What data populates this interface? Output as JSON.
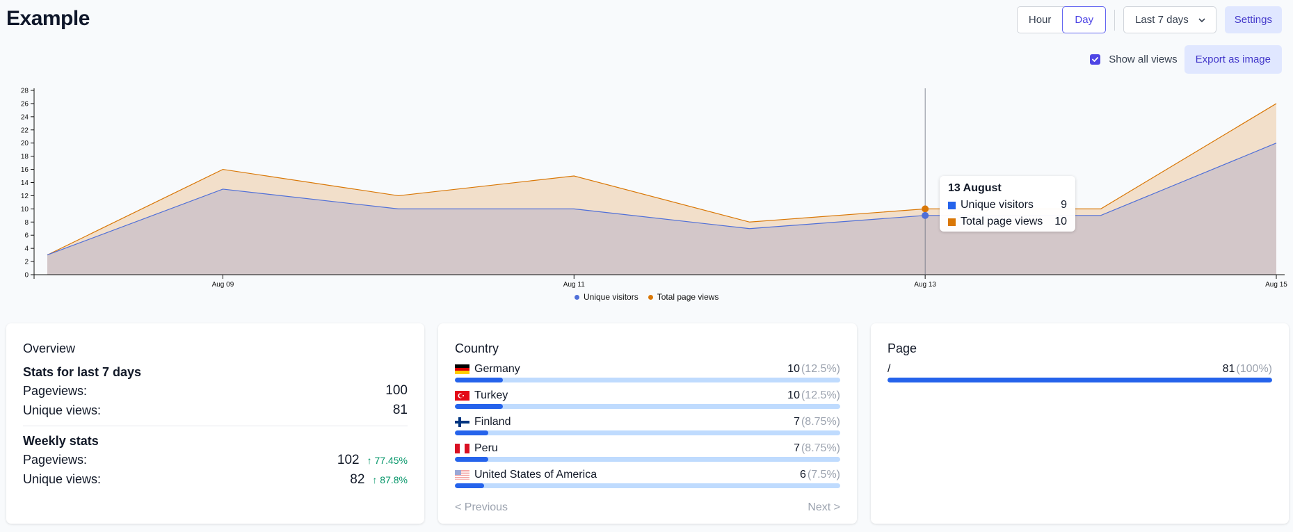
{
  "header": {
    "title": "Example",
    "toggle_hour": "Hour",
    "toggle_day": "Day",
    "range_select": "Last 7 days",
    "settings_label": "Settings"
  },
  "controls": {
    "show_all_views_label": "Show all views",
    "show_all_views_checked": true,
    "export_label": "Export as image"
  },
  "chart_data": {
    "type": "area",
    "x": [
      "Aug 08",
      "Aug 09",
      "Aug 10",
      "Aug 11",
      "Aug 12",
      "Aug 13",
      "Aug 14",
      "Aug 15"
    ],
    "x_tick_labels": [
      "Aug 09",
      "Aug 11",
      "Aug 13",
      "Aug 15"
    ],
    "y_ticks": [
      0,
      2,
      4,
      6,
      8,
      10,
      12,
      14,
      16,
      18,
      20,
      22,
      24,
      26,
      28
    ],
    "ylim": [
      0,
      28
    ],
    "series": [
      {
        "name": "Unique visitors",
        "values": [
          3,
          13,
          10,
          10,
          7,
          9,
          9,
          20
        ],
        "color": "#4f6fd8"
      },
      {
        "name": "Total page views",
        "values": [
          3,
          16,
          12,
          15,
          8,
          10,
          10,
          26
        ],
        "color": "#d97706"
      }
    ],
    "legend_position": "bottom-center",
    "hover_index": 5,
    "tooltip": {
      "title": "13 August",
      "rows": [
        {
          "label": "Unique visitors",
          "value": "9",
          "color": "#2563eb"
        },
        {
          "label": "Total page views",
          "value": "10",
          "color": "#d97706"
        }
      ]
    }
  },
  "overview": {
    "title": "Overview",
    "stats_heading": "Stats for last 7 days",
    "pageviews_label": "Pageviews:",
    "pageviews_value": "100",
    "unique_label": "Unique views:",
    "unique_value": "81",
    "weekly_heading": "Weekly stats",
    "weekly_pageviews_label": "Pageviews:",
    "weekly_pageviews_value": "102",
    "weekly_pageviews_delta": "77.45%",
    "weekly_unique_label": "Unique views:",
    "weekly_unique_value": "82",
    "weekly_unique_delta": "87.8%"
  },
  "country": {
    "title": "Country",
    "items": [
      {
        "name": "Germany",
        "count": "10",
        "pct": "(12.5%)",
        "fraction": 0.125,
        "flag": "de"
      },
      {
        "name": "Turkey",
        "count": "10",
        "pct": "(12.5%)",
        "fraction": 0.125,
        "flag": "tr"
      },
      {
        "name": "Finland",
        "count": "7",
        "pct": "(8.75%)",
        "fraction": 0.0875,
        "flag": "fi"
      },
      {
        "name": "Peru",
        "count": "7",
        "pct": "(8.75%)",
        "fraction": 0.0875,
        "flag": "pe"
      },
      {
        "name": "United States of America",
        "count": "6",
        "pct": "(7.5%)",
        "fraction": 0.075,
        "flag": "us"
      }
    ],
    "prev_label": "< Previous",
    "next_label": "Next >"
  },
  "page": {
    "title": "Page",
    "items": [
      {
        "name": "/",
        "count": "81",
        "pct": "(100%)",
        "fraction": 1.0
      }
    ]
  }
}
